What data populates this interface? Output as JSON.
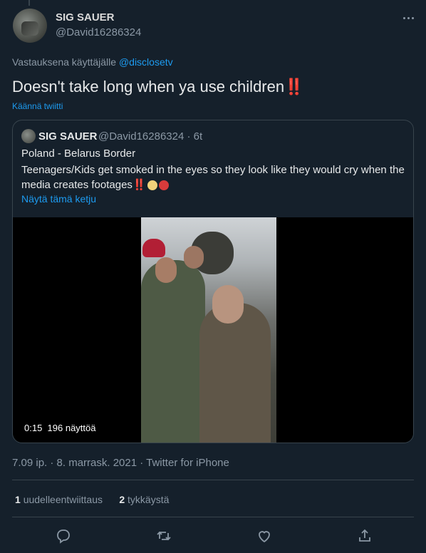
{
  "author": {
    "display_name": "SIG SAUER",
    "handle": "@David16286324"
  },
  "reply": {
    "prefix": "Vastauksena käyttäjälle",
    "to": "@disclosetv"
  },
  "tweet": {
    "text": "Doesn't take long when ya use children",
    "bangs": "‼️",
    "translate_label": "Käännä twiitti"
  },
  "quote": {
    "display_name": "SIG SAUER",
    "handle_time": "@David16286324 · 6t",
    "line1": "Poland - Belarus Border",
    "line2": "Teenagers/Kids get smoked in the eyes so they look like they would cry when the media creates footages",
    "show_thread": "Näytä tämä ketju",
    "video": {
      "duration": "0:15",
      "views": "196 näyttöä"
    }
  },
  "meta": {
    "timestamp": "7.09 ip. · 8. marrask. 2021 · Twitter for iPhone"
  },
  "stats": {
    "retweets_count": "1",
    "retweets_label": "uudelleentwiittaus",
    "likes_count": "2",
    "likes_label": "tykkäystä"
  },
  "icons": [
    "more-icon",
    "reply-icon",
    "retweet-icon",
    "like-icon",
    "share-icon"
  ],
  "colors": {
    "background": "#15202b",
    "link": "#1d9bf0",
    "muted": "#8b98a5",
    "border": "#38444d"
  }
}
